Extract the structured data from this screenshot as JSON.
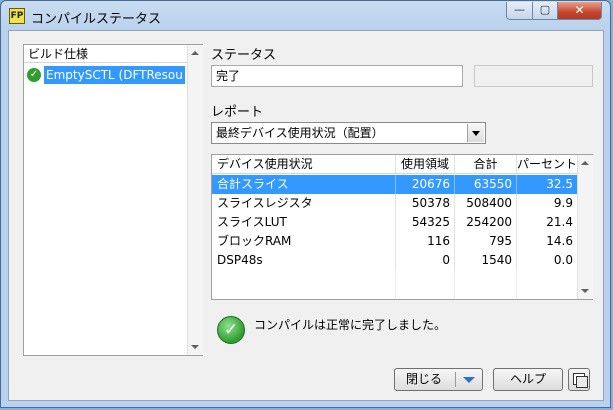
{
  "window": {
    "title": "コンパイルステータス",
    "app_icon": "labview-icon",
    "app_icon_text": "FP",
    "controls": {
      "minimize": "—",
      "maximize": "▢",
      "close": "✕"
    }
  },
  "build_specs": {
    "header": "ビルド仕様",
    "items": [
      {
        "label": "EmptySCTL (DFTResou",
        "status_icon": "success-check-icon"
      }
    ]
  },
  "status": {
    "label": "ステータス",
    "value": "完了"
  },
  "report": {
    "label": "レポート",
    "selected": "最終デバイス使用状況（配置）"
  },
  "usage_table": {
    "columns": [
      "デバイス使用状況",
      "使用領域",
      "合計",
      "パーセント"
    ],
    "rows": [
      {
        "name": "合計スライス",
        "used": "20676",
        "total": "63550",
        "percent": "32.5",
        "selected": true
      },
      {
        "name": "スライスレジスタ",
        "used": "50378",
        "total": "508400",
        "percent": "9.9"
      },
      {
        "name": "スライスLUT",
        "used": "54325",
        "total": "254200",
        "percent": "21.4"
      },
      {
        "name": "ブロックRAM",
        "used": "116",
        "total": "795",
        "percent": "14.6"
      },
      {
        "name": "DSP48s",
        "used": "0",
        "total": "1540",
        "percent": "0.0"
      }
    ]
  },
  "message": {
    "text": "コンパイルは正常に完了しました。",
    "icon": "success-check-icon"
  },
  "buttons": {
    "close": "閉じる",
    "help": "ヘルプ",
    "tool_icon": "copy-window-icon"
  },
  "colors": {
    "selection": "#3399ff",
    "success": "#2e9c2e",
    "dropdown_arrow": "#2f6fd1"
  }
}
